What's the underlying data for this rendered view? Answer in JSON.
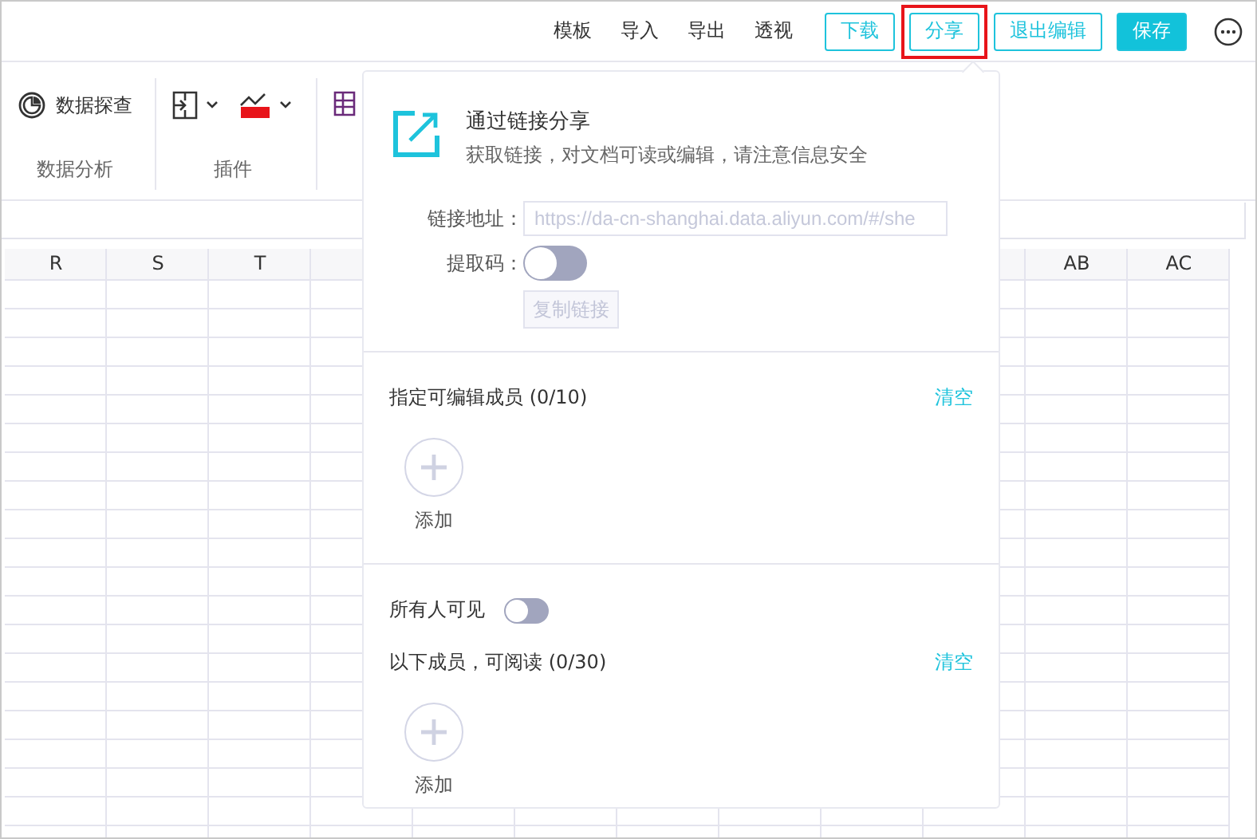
{
  "toolbar": {
    "links": [
      "模板",
      "导入",
      "导出",
      "透视"
    ],
    "buttons": [
      {
        "label": "下载",
        "kind": "outline",
        "highlighted": false
      },
      {
        "label": "分享",
        "kind": "outline",
        "highlighted": true
      },
      {
        "label": "退出编辑",
        "kind": "outline",
        "highlighted": false
      },
      {
        "label": "保存",
        "kind": "primary",
        "highlighted": false
      }
    ]
  },
  "ribbon": {
    "groups": [
      {
        "label": "数据分析",
        "tool": "数据探查"
      },
      {
        "label": "插件"
      }
    ]
  },
  "grid": {
    "columns_left": [
      "R",
      "S",
      "T"
    ],
    "columns_right": [
      "AB",
      "AC"
    ]
  },
  "share_popover": {
    "title": "通过链接分享",
    "subtitle": "获取链接，对文档可读或编辑，请注意信息安全",
    "link_label": "链接地址：",
    "link_value": "https://da-cn-shanghai.data.aliyun.com/#/she",
    "code_label": "提取码：",
    "code_toggle": {
      "on": false
    },
    "copy_button": {
      "label": "复制链接",
      "disabled": true
    },
    "sections": [
      {
        "kind": "members",
        "title": "指定可编辑成员",
        "count": "(0/10)",
        "clear": "清空",
        "add_label": "添加"
      },
      {
        "kind": "public",
        "label": "所有人可见",
        "on": false
      },
      {
        "kind": "members",
        "title": "以下成员，可阅读",
        "count": "(0/30)",
        "clear": "清空",
        "add_label": "添加"
      }
    ]
  }
}
